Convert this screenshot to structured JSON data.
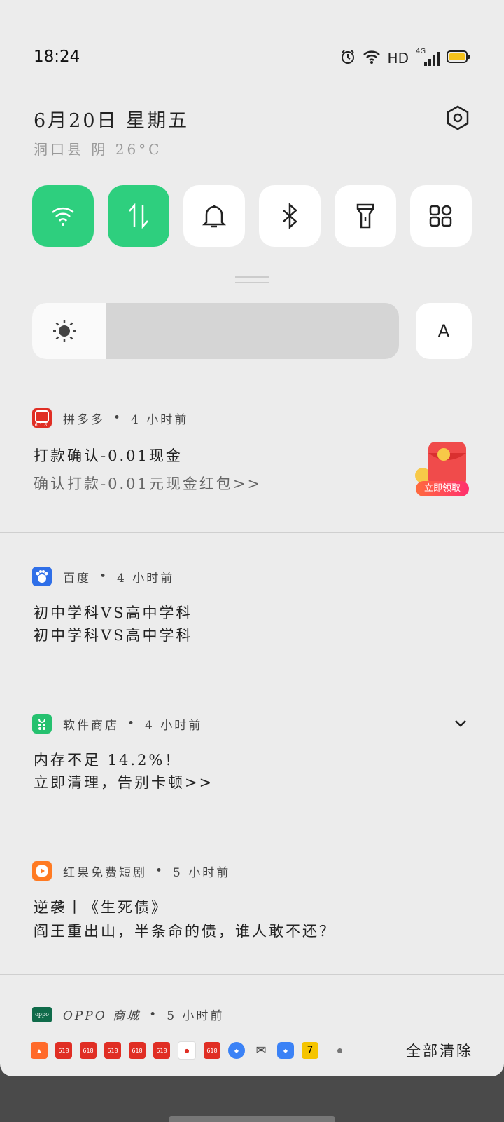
{
  "status": {
    "time": "18:24",
    "network": "HD",
    "signal": "4G"
  },
  "header": {
    "date": "6月20日  星期五",
    "weather": "洞口县 阴 26°C"
  },
  "quick_tiles": [
    {
      "name": "wifi",
      "active": true
    },
    {
      "name": "mobile-data",
      "active": true
    },
    {
      "name": "sound",
      "active": false
    },
    {
      "name": "bluetooth",
      "active": false
    },
    {
      "name": "flashlight",
      "active": false
    },
    {
      "name": "more",
      "active": false
    }
  ],
  "brightness": {
    "level_fraction": 0.2,
    "auto_label": "A"
  },
  "notifications": [
    {
      "app": "拼多多",
      "time": "4 小时前",
      "title": "打款确认-0.01现金",
      "text": "确认打款-0.01元现金红包>>",
      "badge": "立即领取",
      "icon_badge": "618"
    },
    {
      "app": "百度",
      "time": "4 小时前",
      "title": "初中学科VS高中学科",
      "text": "初中学科VS高中学科"
    },
    {
      "app": "软件商店",
      "time": "4 小时前",
      "title": "内存不足 14.2%！",
      "text": "立即清理，告别卡顿>>"
    },
    {
      "app": "红果免费短剧",
      "time": "5 小时前",
      "title": "逆袭丨《生死债》",
      "text": "阎王重出山，半条命的债，谁人敢不还？"
    },
    {
      "app": "OPPO 商城",
      "time": "5 小时前",
      "icon_label": "oppo"
    }
  ],
  "bottom": {
    "clear_all": "全部清除",
    "mini_badge": "618"
  },
  "colors": {
    "accent_green": "#2ecf7e",
    "pdd_red": "#e02e24",
    "panel_bg": "#ececec"
  }
}
